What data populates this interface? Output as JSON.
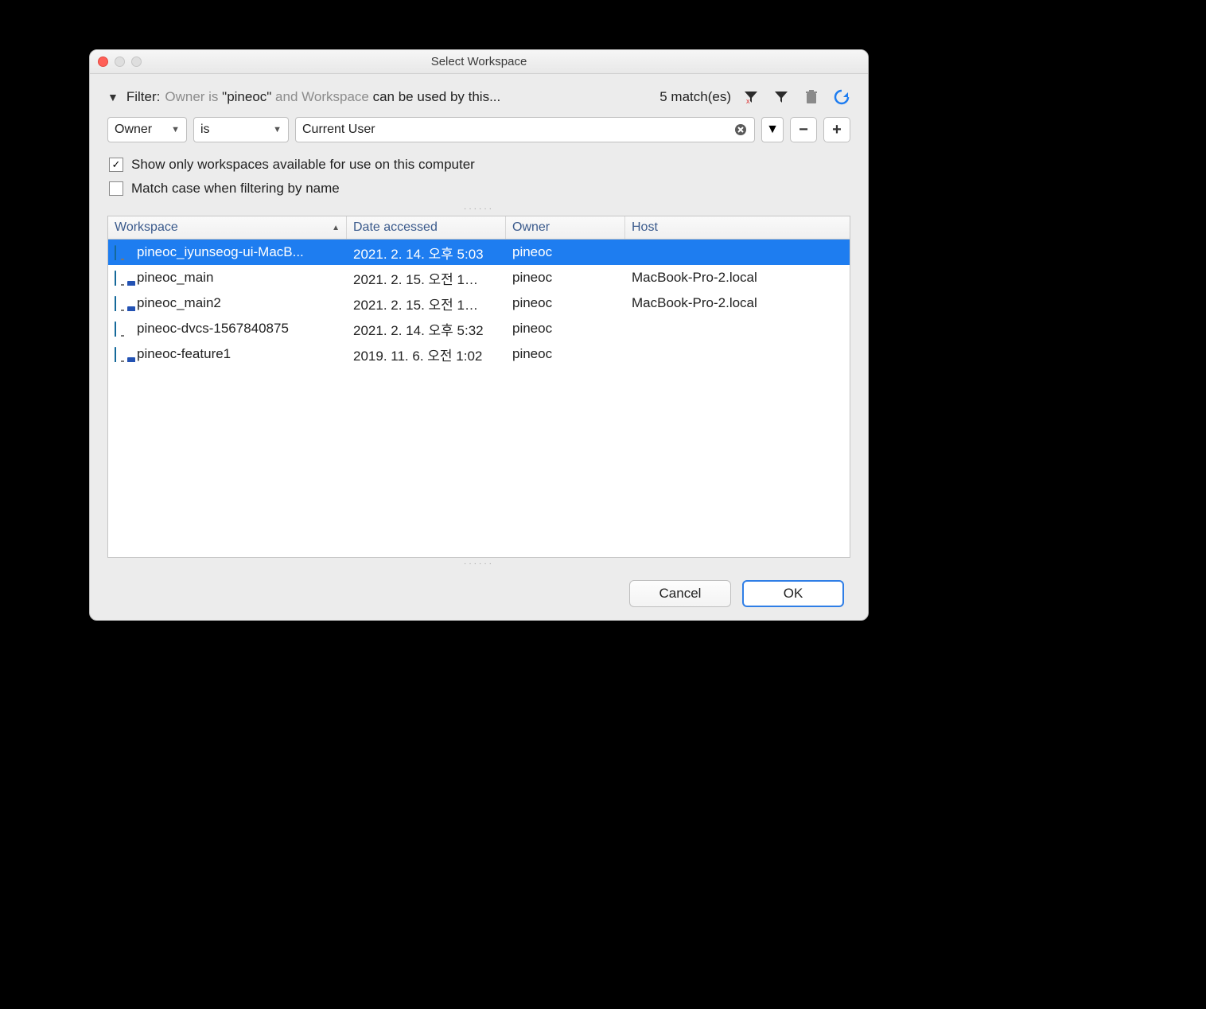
{
  "window": {
    "title": "Select Workspace"
  },
  "filter": {
    "label": "Filter:",
    "prefix": "Owner is ",
    "quoted": "\"pineoc\"",
    "mid": " and Workspace ",
    "suffix": "can be used by this...",
    "match_text": "5 match(es)"
  },
  "condition": {
    "field": "Owner",
    "op": "is",
    "value": "Current User"
  },
  "checks": {
    "only_avail": "Show only workspaces available for use on this computer",
    "match_case": "Match case when filtering by name"
  },
  "table": {
    "columns": {
      "ws": "Workspace",
      "date": "Date accessed",
      "owner": "Owner",
      "host": "Host"
    },
    "rows": [
      {
        "ws": "pineoc_iyunseog-ui-MacB...",
        "date": "2021. 2. 14. 오후 5:03",
        "owner": "pineoc",
        "host": "",
        "icon": "plain",
        "selected": true
      },
      {
        "ws": "pineoc_main",
        "date": "2021. 2. 15. 오전 1…",
        "owner": "pineoc",
        "host": "MacBook-Pro-2.local",
        "icon": "net",
        "selected": false
      },
      {
        "ws": "pineoc_main2",
        "date": "2021. 2. 15. 오전 1…",
        "owner": "pineoc",
        "host": "MacBook-Pro-2.local",
        "icon": "net",
        "selected": false
      },
      {
        "ws": "pineoc-dvcs-1567840875",
        "date": "2021. 2. 14. 오후 5:32",
        "owner": "pineoc",
        "host": "",
        "icon": "plain",
        "selected": false
      },
      {
        "ws": "pineoc-feature1",
        "date": "2019. 11. 6. 오전 1:02",
        "owner": "pineoc",
        "host": "",
        "icon": "net",
        "selected": false
      }
    ]
  },
  "buttons": {
    "cancel": "Cancel",
    "ok": "OK"
  }
}
